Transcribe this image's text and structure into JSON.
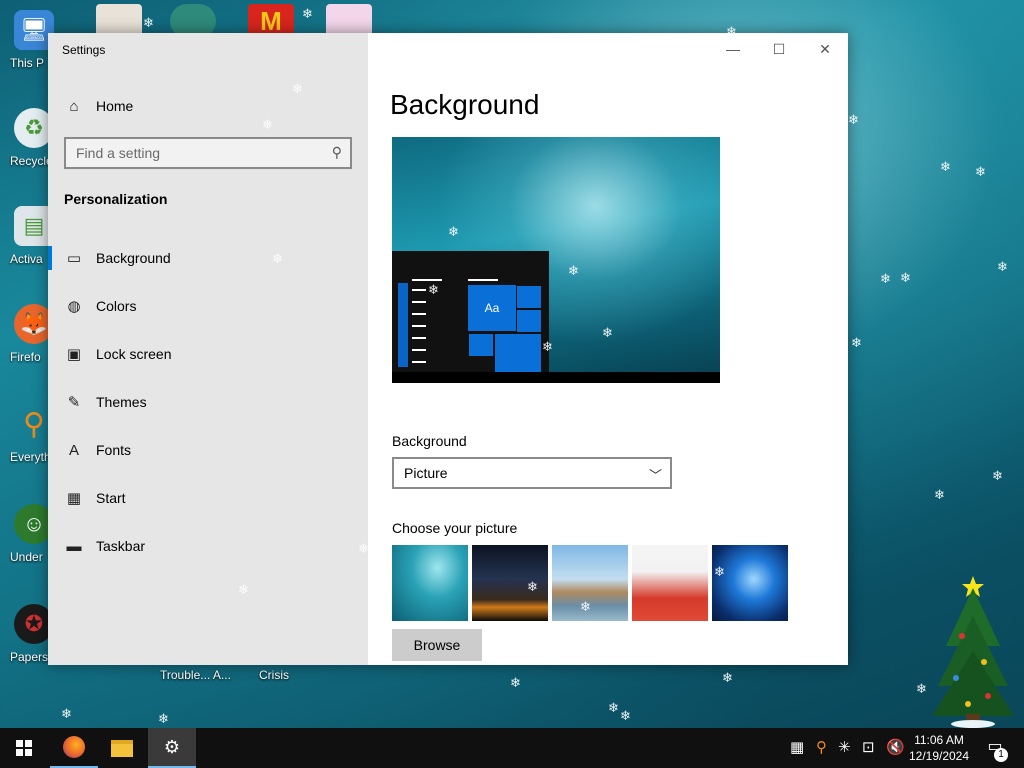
{
  "desktop": {
    "icons": [
      {
        "label": "This P",
        "name": "this-pc",
        "color": "#3a86d6"
      },
      {
        "label": "Recycle",
        "name": "recycle-bin",
        "color": "#7fbf5a"
      },
      {
        "label": "Activa",
        "name": "activate",
        "color": "#dfe6e9"
      },
      {
        "label": "Firefo",
        "name": "firefox",
        "color": "#e8662c"
      },
      {
        "label": "Everyth",
        "name": "everything",
        "color": "#f08a18"
      },
      {
        "label": "Under",
        "name": "undertale",
        "color": "#2d7a2d"
      },
      {
        "label": "Papers, P",
        "name": "papers-please",
        "color": "#1a1a1a"
      }
    ],
    "bottom_labels": [
      "Trouble... A...",
      "Crisis"
    ]
  },
  "window": {
    "title": "Settings",
    "caption": {
      "minimize": "—",
      "maximize": "☐",
      "close": "✕"
    }
  },
  "sidebar": {
    "home": "Home",
    "search_placeholder": "Find a setting",
    "section": "Personalization",
    "items": [
      {
        "label": "Background",
        "icon": "picture-icon",
        "glyph": "▭"
      },
      {
        "label": "Colors",
        "icon": "palette-icon",
        "glyph": "◍"
      },
      {
        "label": "Lock screen",
        "icon": "lock-screen-icon",
        "glyph": "▣"
      },
      {
        "label": "Themes",
        "icon": "themes-icon",
        "glyph": "✎"
      },
      {
        "label": "Fonts",
        "icon": "fonts-icon",
        "glyph": "A"
      },
      {
        "label": "Start",
        "icon": "start-icon",
        "glyph": "▦"
      },
      {
        "label": "Taskbar",
        "icon": "taskbar-icon",
        "glyph": "▬"
      }
    ],
    "active_index": 0
  },
  "main": {
    "title": "Background",
    "preview_tile_text": "Aa",
    "background_label": "Background",
    "background_value": "Picture",
    "choose_label": "Choose your picture",
    "browse": "Browse"
  },
  "taskbar": {
    "time": "11:06 AM",
    "date": "12/19/2024",
    "notification_count": "1",
    "accent": "#76b9ed"
  }
}
